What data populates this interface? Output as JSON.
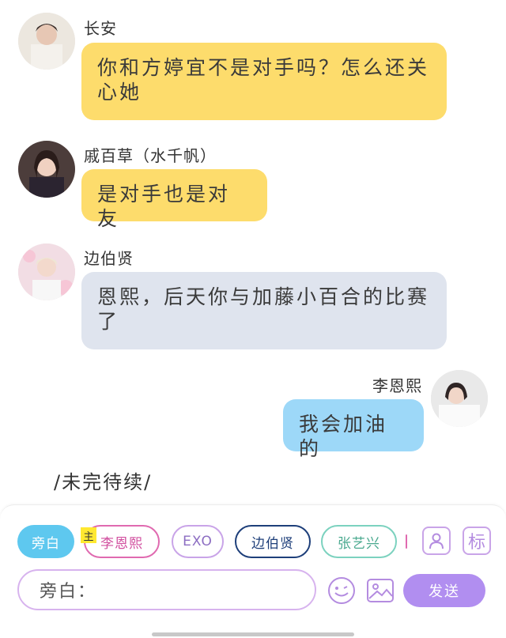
{
  "messages": [
    {
      "sender": "长安",
      "text": "你和方婷宜不是对手吗？怎么还关心她",
      "color": "#fddc6c"
    },
    {
      "sender": "戚百草（水千帆）",
      "text": "是对手也是对友",
      "color": "#fddc6c"
    },
    {
      "sender": "边伯贤",
      "text": "恩熙，后天你与加藤小百合的比赛了",
      "color": "#dfe4ee"
    },
    {
      "sender": "李恩熙",
      "text": "我会加油的",
      "color": "#9dd8f8"
    }
  ],
  "to_be_continued": "/未完待续/",
  "composer": {
    "role_chips": [
      {
        "label": "旁白",
        "icon": "narration-chip"
      },
      {
        "label": "李恩熙",
        "badge": "主"
      },
      {
        "label": "EXO"
      },
      {
        "label": "边伯贤"
      },
      {
        "label": "张艺兴"
      }
    ],
    "input_label": "旁白：",
    "send_label": "发送",
    "tag_button": "标",
    "icons": [
      "person-icon",
      "tag-icon",
      "emoji-icon",
      "image-icon"
    ]
  }
}
